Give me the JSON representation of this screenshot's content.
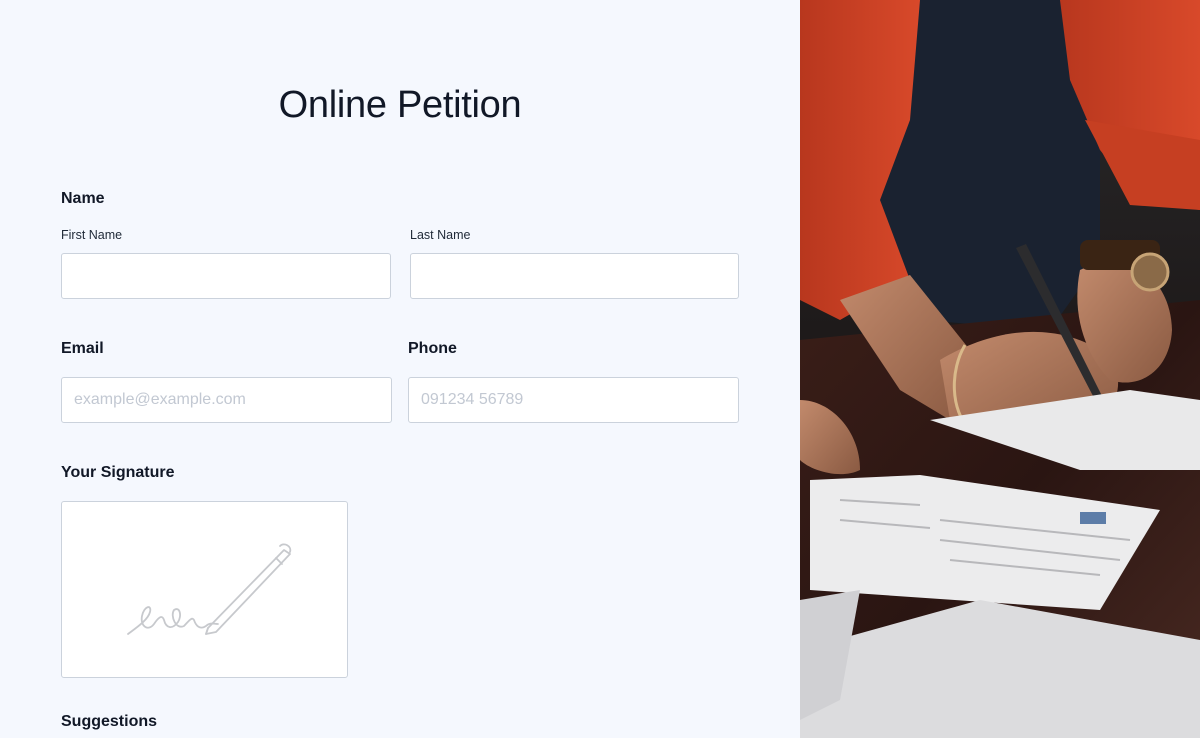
{
  "form": {
    "title": "Online Petition",
    "name_section": {
      "label": "Name",
      "first_name": {
        "label": "First Name",
        "value": "",
        "placeholder": ""
      },
      "last_name": {
        "label": "Last Name",
        "value": "",
        "placeholder": ""
      }
    },
    "email": {
      "label": "Email",
      "value": "",
      "placeholder": "example@example.com"
    },
    "phone": {
      "label": "Phone",
      "value": "",
      "placeholder": "091234 56789"
    },
    "signature": {
      "label": "Your Signature",
      "icon": "signature-pen-icon"
    },
    "suggestions": {
      "label": "Suggestions"
    }
  },
  "colors": {
    "page_bg": "#f5f8fe",
    "text": "#111827",
    "field_border": "#cbd2dc",
    "placeholder": "#c2c8d2"
  }
}
